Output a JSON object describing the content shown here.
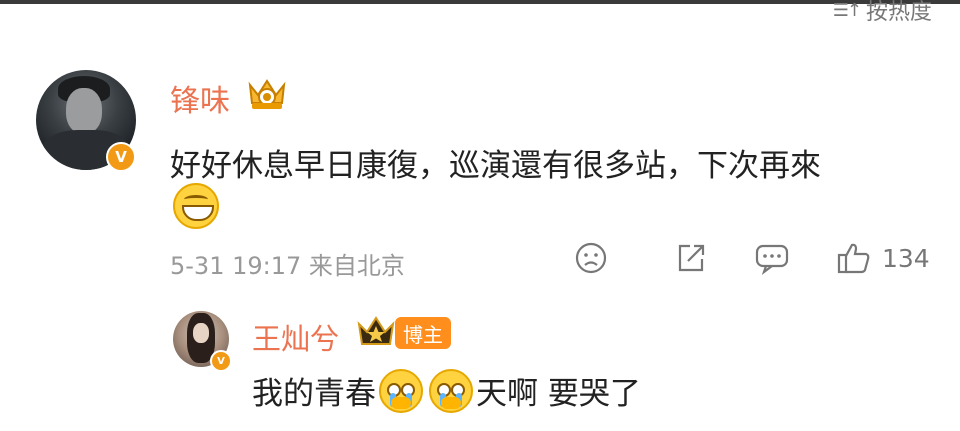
{
  "header": {
    "sort_label": "按热度",
    "sort_icon": "sort-icon"
  },
  "comment": {
    "username": "锋味",
    "text": "好好休息早日康復，巡演還有很多站，下次再來",
    "time": "5-31 19:17",
    "location": "来自北京",
    "likes": "134",
    "verified_mark": "V",
    "emoji": "grinning-face"
  },
  "reply": {
    "username": "王灿兮",
    "badge": "博主",
    "text_before": "我的青春",
    "text_after": "天啊 要哭了",
    "verified_mark": "V",
    "emoji": "crying-face-with-hands"
  },
  "colors": {
    "username": "#eb7350",
    "badge": "#ff8e1d",
    "verified": "#f29a16",
    "meta": "#999999"
  }
}
